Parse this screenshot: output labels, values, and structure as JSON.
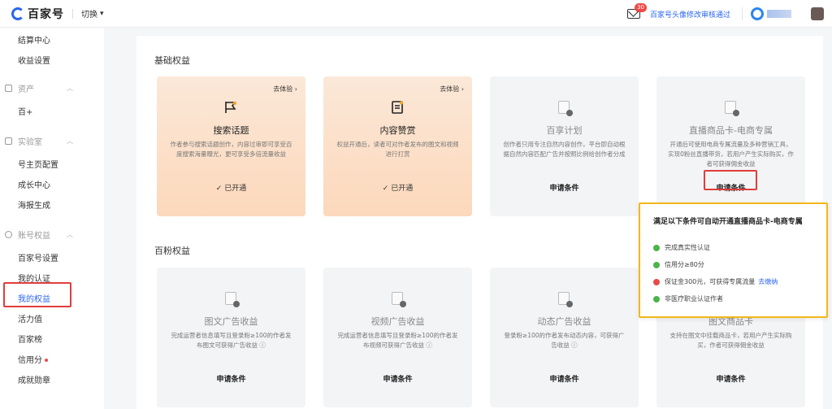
{
  "header": {
    "brand": "百家号",
    "switch_label": "切换",
    "mail_badge": "30",
    "notice": "百家号头像修改审核通过"
  },
  "sidebar": {
    "items": [
      {
        "label": "结算中心"
      },
      {
        "label": "收益设置"
      },
      {
        "label": "资产",
        "group": true
      },
      {
        "label": "百+"
      },
      {
        "label": "实验室",
        "group": true
      },
      {
        "label": "号主页配置"
      },
      {
        "label": "成长中心"
      },
      {
        "label": "海报生成"
      },
      {
        "label": "账号权益",
        "group": true
      },
      {
        "label": "百家号设置"
      },
      {
        "label": "我的认证"
      },
      {
        "label": "我的权益",
        "active": true
      },
      {
        "label": "活力值"
      },
      {
        "label": "百家榜"
      },
      {
        "label": "信用分"
      },
      {
        "label": "成就勋章"
      }
    ]
  },
  "sections": {
    "basic": "基础权益",
    "fans": "百粉权益"
  },
  "basic_cards": [
    {
      "title": "搜索话题",
      "exp": "去体验 ›",
      "desc": "作者参与搜索话题创作，内容过审即可享受百度搜索海量曝光，更可享受多倍流量收益",
      "status": "✓ 已开通"
    },
    {
      "title": "内容赞赏",
      "exp": "去体验 ›",
      "desc": "权益开通后，读者可对作者发布的图文和视频进行打赏",
      "status": "✓ 已开通"
    },
    {
      "title": "百享计划",
      "desc": "创作者只用专注自然内容创作，平台即自动根据自然内容匹配广告并按照比例给创作者分成",
      "apply": "申请条件"
    },
    {
      "title": "直播商品卡-电商专属",
      "desc": "开通后可使用电商专属流量及多种营销工具，实现0粉丝直播带货，若用户产生实际购买，作者可获得佣金收益",
      "apply": "申请条件"
    }
  ],
  "fans_cards": [
    {
      "title": "图文广告收益",
      "desc": "完成运营者信息填写且登录粉≥100的作者发布图文可获得广告收益 ⓘ",
      "apply": "申请条件"
    },
    {
      "title": "视频广告收益",
      "desc": "完成运营者信息填写且登录粉≥100的作者发布视频可获得广告收益 ⓘ",
      "apply": "申请条件"
    },
    {
      "title": "动态广告收益",
      "desc": "登录粉≥100的作者发布动态内容，可获得广告收益 ⓘ",
      "apply": "申请条件"
    },
    {
      "title": "图文商品卡",
      "desc": "支持在图文中挂载商品卡，若用户产生实际购买，作者可获得佣金收益",
      "apply": "申请条件"
    }
  ],
  "popup": {
    "title": "满足以下条件可自动开通直播商品卡-电商专属",
    "rows": [
      {
        "text": "完成真实性认证",
        "ok": true
      },
      {
        "text": "信用分≥80分",
        "ok": true
      },
      {
        "text": "保证金300元，可获得专属流量",
        "ok": false,
        "link": "去缴纳"
      },
      {
        "text": "非医疗职业认证作者",
        "ok": true
      }
    ]
  },
  "colors": {
    "accent": "#2b65f0",
    "ok": "#4bb548",
    "bad": "#e84848",
    "highlight": "#e03d3d",
    "popup_border": "#f2b81a"
  }
}
